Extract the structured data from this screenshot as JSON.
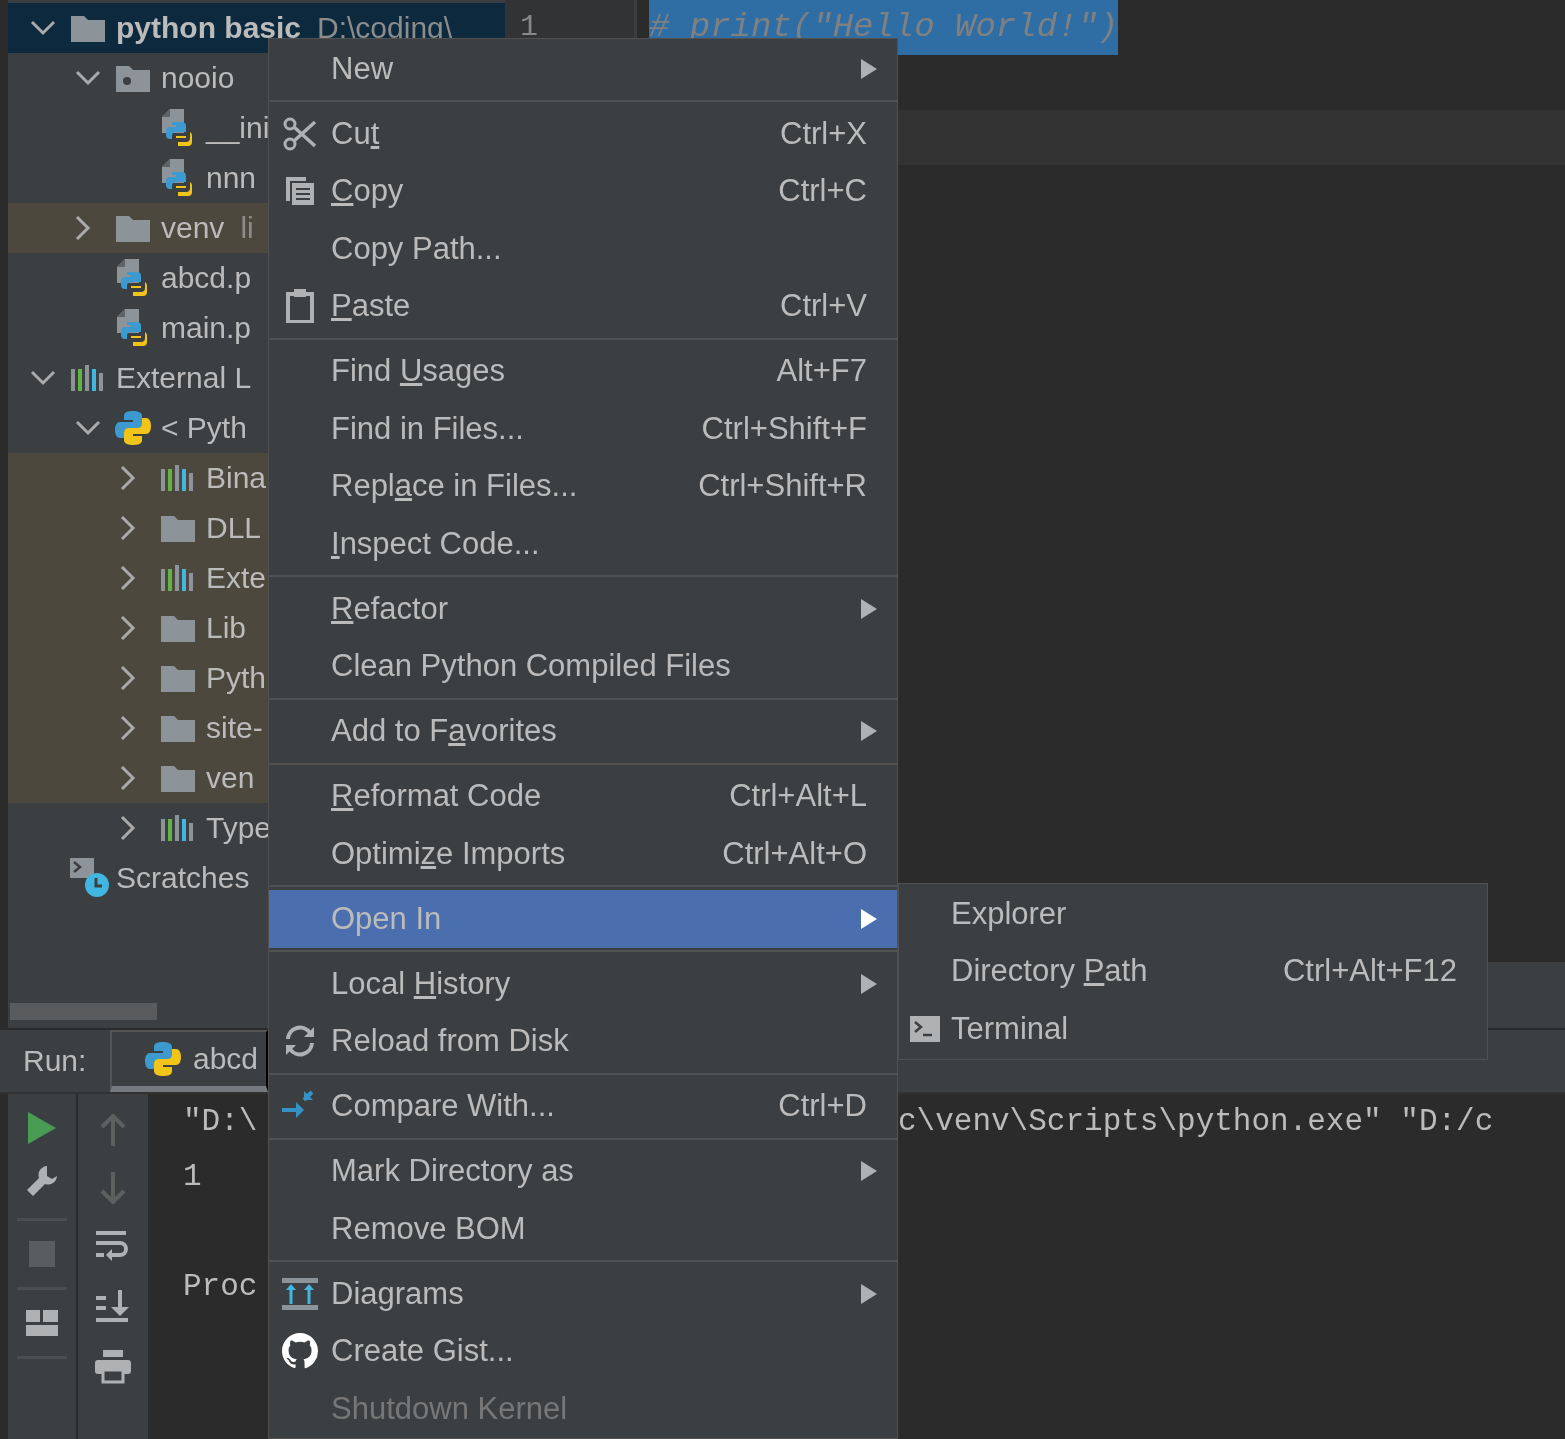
{
  "project_tree": {
    "nodes": [
      {
        "label": "python basic",
        "path": "D:\\coding\\",
        "kind": "folder",
        "expanded": true,
        "selected": true,
        "highlighted": false,
        "children": [
          {
            "label": "nooio",
            "kind": "package",
            "expanded": true,
            "selected": false,
            "highlighted": false,
            "children": [
              {
                "label": "__ini",
                "kind": "python-file",
                "selected": false,
                "highlighted": false
              },
              {
                "label": "nnn",
                "kind": "python-file",
                "selected": false,
                "highlighted": false
              }
            ]
          },
          {
            "label": "venv",
            "path": "li",
            "kind": "folder",
            "expanded": false,
            "selected": false,
            "highlighted": true
          },
          {
            "label": "abcd.p",
            "kind": "python-file",
            "selected": false,
            "highlighted": false
          },
          {
            "label": "main.p",
            "kind": "python-file",
            "selected": false,
            "highlighted": false
          }
        ]
      },
      {
        "label": "External L",
        "kind": "library",
        "expanded": true,
        "selected": false,
        "highlighted": false,
        "children": [
          {
            "label": "< Pyth",
            "kind": "python",
            "expanded": true,
            "selected": false,
            "highlighted": false,
            "children": [
              {
                "label": "Bina",
                "kind": "library",
                "expanded": false,
                "selected": false,
                "highlighted": true
              },
              {
                "label": "DLL",
                "kind": "folder",
                "expanded": false,
                "selected": false,
                "highlighted": true
              },
              {
                "label": "Exte",
                "kind": "library",
                "expanded": false,
                "selected": false,
                "highlighted": true
              },
              {
                "label": "Lib",
                "kind": "folder",
                "expanded": false,
                "selected": false,
                "highlighted": true
              },
              {
                "label": "Pyth",
                "kind": "folder",
                "expanded": false,
                "selected": false,
                "highlighted": true
              },
              {
                "label": "site-",
                "kind": "folder",
                "expanded": false,
                "selected": false,
                "highlighted": true
              },
              {
                "label": "ven",
                "kind": "folder",
                "expanded": false,
                "selected": false,
                "highlighted": true
              },
              {
                "label": "Type",
                "kind": "library",
                "expanded": false,
                "selected": false,
                "highlighted": false
              }
            ]
          }
        ]
      },
      {
        "label": "Scratches",
        "kind": "scratches",
        "selected": false,
        "highlighted": false
      }
    ]
  },
  "editor": {
    "line_numbers": [
      "1"
    ],
    "lines": [
      {
        "text": "# print(\"Hello World!\")",
        "selected": true
      }
    ]
  },
  "run_panel": {
    "label": "Run:",
    "tabs": [
      {
        "label": "abcd",
        "selected": true
      }
    ],
    "console_lines": [
      {
        "text": "\"D:\\",
        "text_right": "c\\venv\\Scripts\\python.exe\" \"D:/c",
        "gap_before": false
      },
      {
        "text": "1",
        "gap_before": false
      },
      {
        "text": "Proc",
        "gap_before": true
      }
    ]
  },
  "context_menu": {
    "items": [
      {
        "kind": "item",
        "label": "New",
        "submenu": true,
        "selected": false,
        "disabled": false
      },
      {
        "kind": "separator"
      },
      {
        "kind": "scissors",
        "label": "Cu",
        "underline": "t",
        "shortcut": "Ctrl+X",
        "submenu": false,
        "selected": false,
        "disabled": false
      },
      {
        "kind": "copy",
        "underline": "C",
        "label_end": "opy",
        "shortcut": "Ctrl+C",
        "submenu": false,
        "selected": false,
        "disabled": false
      },
      {
        "kind": "item",
        "label": "Copy Path...",
        "submenu": false,
        "selected": false,
        "disabled": false
      },
      {
        "kind": "paste",
        "underline": "P",
        "label_end": "aste",
        "shortcut": "Ctrl+V",
        "submenu": false,
        "selected": false,
        "disabled": false
      },
      {
        "kind": "separator"
      },
      {
        "kind": "item",
        "label": "Find ",
        "underline": "U",
        "label_end": "sages",
        "shortcut": "Alt+F7",
        "submenu": false,
        "selected": false,
        "disabled": false
      },
      {
        "kind": "item",
        "label": "Find in Files...",
        "shortcut": "Ctrl+Shift+F",
        "submenu": false,
        "selected": false,
        "disabled": false
      },
      {
        "kind": "item",
        "label": "Repl",
        "underline": "a",
        "label_end": "ce in Files...",
        "shortcut": "Ctrl+Shift+R",
        "submenu": false,
        "selected": false,
        "disabled": false
      },
      {
        "kind": "item",
        "underline": "I",
        "label_end": "nspect Code...",
        "submenu": false,
        "selected": false,
        "disabled": false
      },
      {
        "kind": "separator"
      },
      {
        "kind": "item",
        "underline": "R",
        "label_end": "efactor",
        "submenu": true,
        "selected": false,
        "disabled": false
      },
      {
        "kind": "item",
        "label": "Clean Python Compiled Files",
        "submenu": false,
        "selected": false,
        "disabled": false
      },
      {
        "kind": "separator"
      },
      {
        "kind": "item",
        "label": "Add to F",
        "underline": "a",
        "label_end": "vorites",
        "submenu": true,
        "selected": false,
        "disabled": false
      },
      {
        "kind": "separator"
      },
      {
        "kind": "item",
        "underline": "R",
        "label_end": "eformat Code",
        "shortcut": "Ctrl+Alt+L",
        "submenu": false,
        "selected": false,
        "disabled": false
      },
      {
        "kind": "item",
        "label": "Optimi",
        "underline": "z",
        "label_end": "e Imports",
        "shortcut": "Ctrl+Alt+O",
        "submenu": false,
        "selected": false,
        "disabled": false
      },
      {
        "kind": "separator"
      },
      {
        "kind": "item",
        "label": "Open In",
        "submenu": true,
        "selected": true,
        "disabled": false
      },
      {
        "kind": "separator"
      },
      {
        "kind": "item",
        "label": "Local ",
        "underline": "H",
        "label_end": "istory",
        "submenu": true,
        "selected": false,
        "disabled": false
      },
      {
        "kind": "reload",
        "label": "Reload from Disk",
        "submenu": false,
        "selected": false,
        "disabled": false
      },
      {
        "kind": "separator"
      },
      {
        "kind": "compare",
        "label": "Compare With...",
        "shortcut": "Ctrl+D",
        "submenu": false,
        "selected": false,
        "disabled": false
      },
      {
        "kind": "separator"
      },
      {
        "kind": "item",
        "label": "Mark Directory as",
        "submenu": true,
        "selected": false,
        "disabled": false
      },
      {
        "kind": "item",
        "label": "Remove BOM",
        "submenu": false,
        "selected": false,
        "disabled": false
      },
      {
        "kind": "separator"
      },
      {
        "kind": "diagram",
        "label": "Diagrams",
        "submenu": true,
        "selected": false,
        "disabled": false
      },
      {
        "kind": "github",
        "label": "Create Gist...",
        "submenu": false,
        "selected": false,
        "disabled": false
      },
      {
        "kind": "item",
        "label": "Shutdown Kernel",
        "submenu": false,
        "selected": false,
        "disabled": true
      }
    ]
  },
  "submenu": {
    "items": [
      {
        "kind": "item",
        "label": "Explorer",
        "submenu": false,
        "selected": false,
        "disabled": false
      },
      {
        "kind": "item",
        "label": "Directory ",
        "underline": "P",
        "label_end": "ath",
        "shortcut": "Ctrl+Alt+F12",
        "submenu": false,
        "selected": false,
        "disabled": false
      },
      {
        "kind": "terminal",
        "label": "Terminal",
        "submenu": false,
        "selected": false,
        "disabled": false
      }
    ]
  }
}
